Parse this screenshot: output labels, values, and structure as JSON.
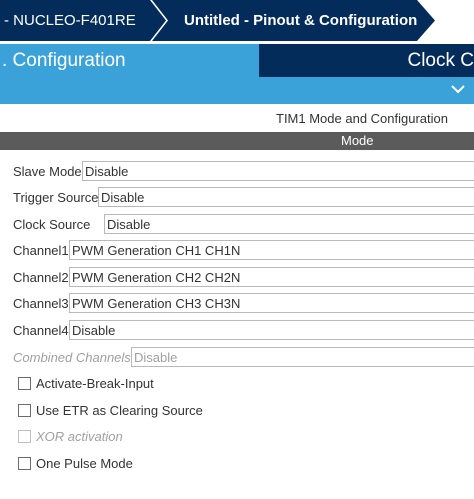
{
  "breadcrumb": {
    "items": [
      {
        "label": "-  NUCLEO-F401RE"
      },
      {
        "label": "Untitled - Pinout & Configuration"
      }
    ]
  },
  "tabs": {
    "configuration": ". Configuration",
    "clock": "Clock C"
  },
  "section": {
    "title": "TIM1 Mode and Configuration",
    "mode_header": "Mode"
  },
  "fields": [
    {
      "label": "Slave Mode",
      "value": "Disable",
      "enabled": true
    },
    {
      "label": "Trigger Source",
      "value": "Disable",
      "enabled": true
    },
    {
      "label": "Clock Source",
      "value": "Disable",
      "enabled": true
    },
    {
      "label": "Channel1",
      "value": "PWM Generation CH1 CH1N",
      "enabled": true
    },
    {
      "label": "Channel2",
      "value": "PWM Generation CH2 CH2N",
      "enabled": true
    },
    {
      "label": "Channel3",
      "value": "PWM Generation CH3 CH3N",
      "enabled": true
    },
    {
      "label": "Channel4",
      "value": "Disable",
      "enabled": true
    },
    {
      "label": "Combined Channels",
      "value": "Disable",
      "enabled": false
    }
  ],
  "checkboxes": [
    {
      "label": "Activate-Break-Input",
      "checked": false,
      "enabled": true
    },
    {
      "label": "Use ETR as Clearing Source",
      "checked": false,
      "enabled": true
    },
    {
      "label": "XOR activation",
      "checked": false,
      "enabled": false
    },
    {
      "label": "One Pulse Mode",
      "checked": false,
      "enabled": true
    }
  ],
  "colors": {
    "navy": "#042c5b",
    "accent_blue": "#3aa2d9",
    "mode_bar": "#5b5b5b"
  }
}
